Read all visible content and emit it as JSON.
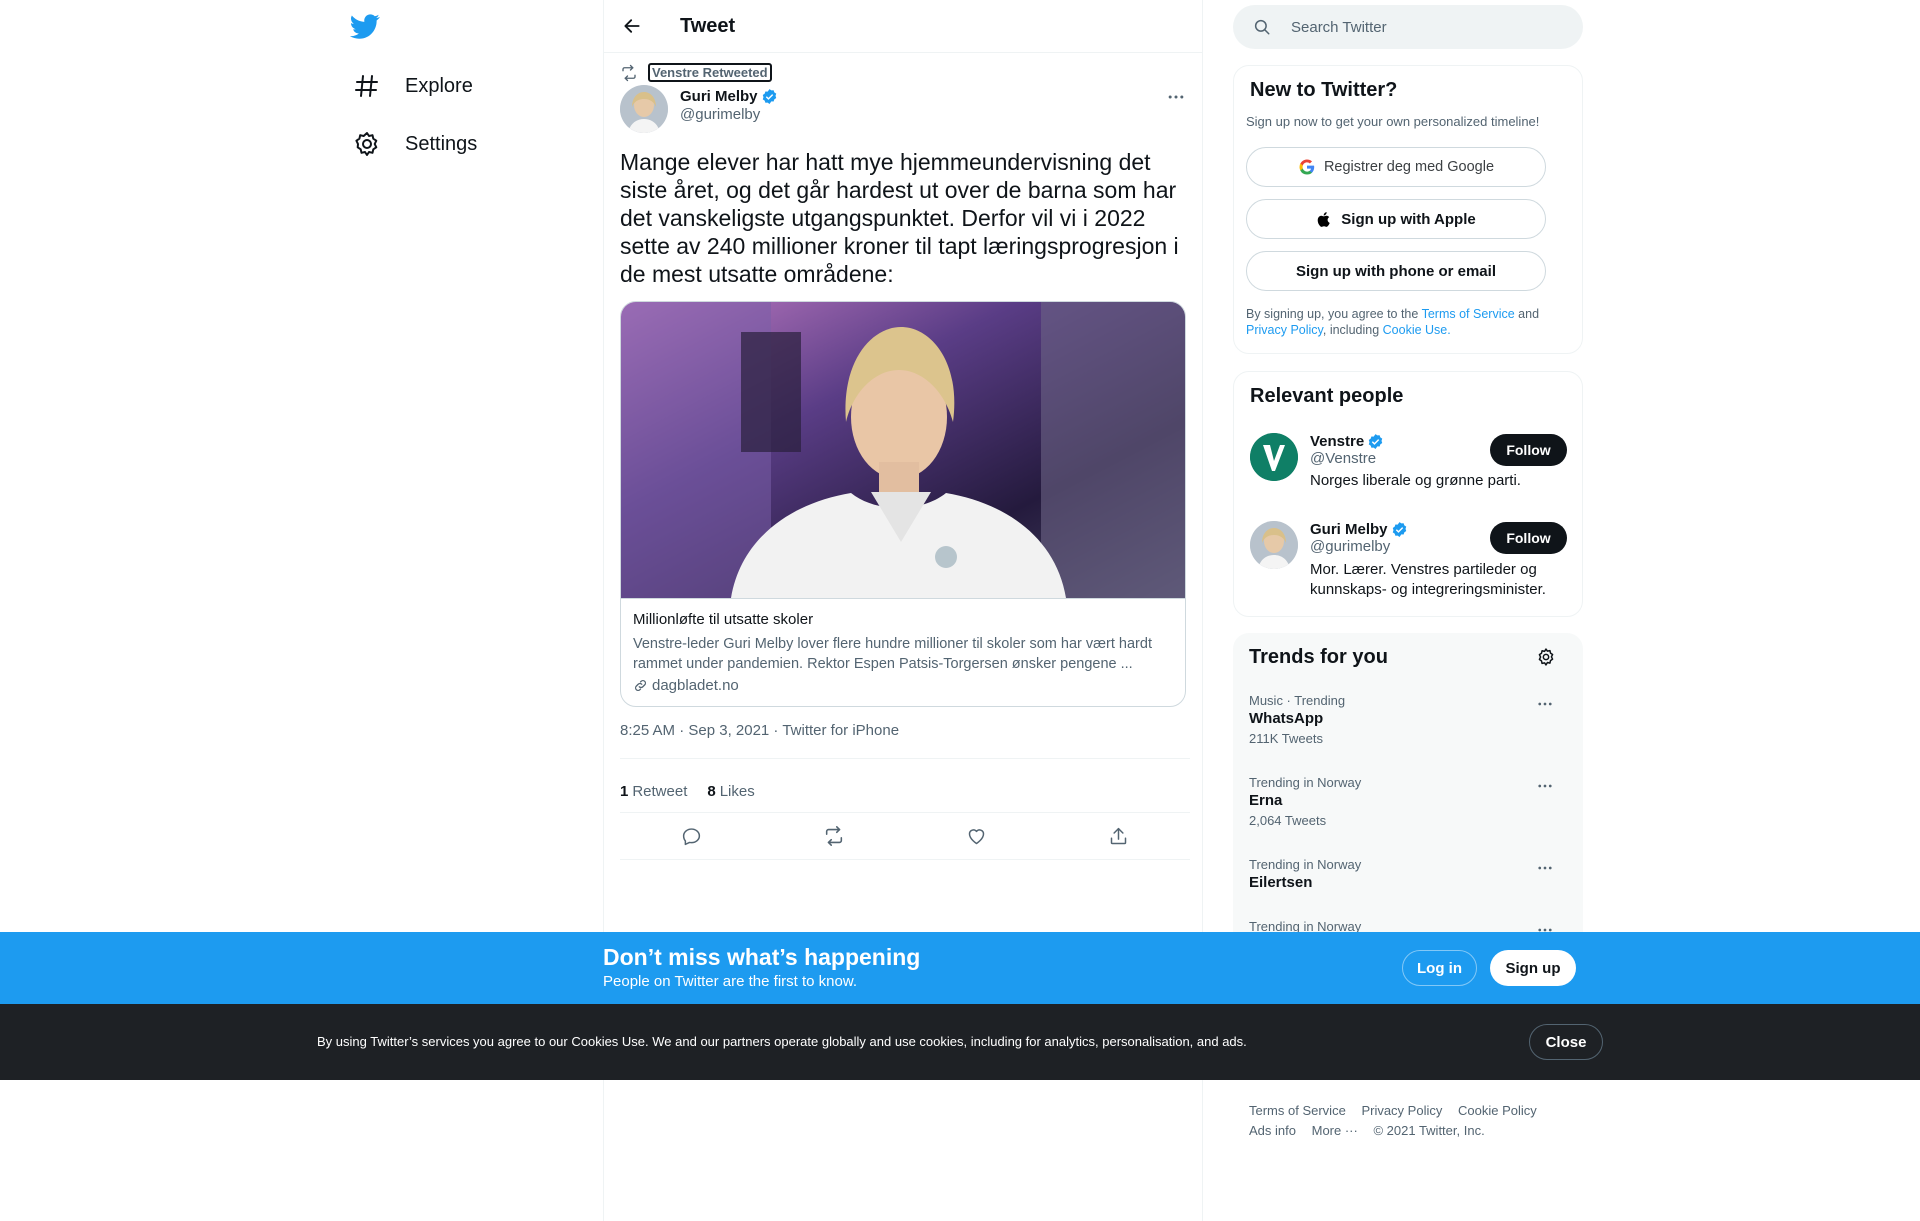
{
  "nav": {
    "items": [
      {
        "label": "Explore",
        "icon": "hashtag-icon"
      },
      {
        "label": "Settings",
        "icon": "gear-icon"
      }
    ]
  },
  "header": {
    "title": "Tweet"
  },
  "tweet": {
    "retweeted_by": "Venstre Retweeted",
    "author_name": "Guri Melby",
    "author_handle": "@gurimelby",
    "text": "Mange elever har hatt mye hjemmeundervisning det siste året, og det går hardest ut over de barna som har det vanskeligste utgangspunktet. Derfor vil vi i 2022 sette av 240 millioner kroner til tapt læringsprogresjon i de mest utsatte områdene:",
    "card": {
      "title": "Millionløfte til utsatte skoler",
      "description": "Venstre-leder Guri Melby lover flere hundre millioner til skoler som har vært hardt rammet under pandemien. Rektor Espen Patsis-Torgersen ønsker pengene ...",
      "domain": "dagbladet.no"
    },
    "meta": "8:25 AM · Sep 3, 2021 · Twitter for iPhone",
    "retweet_count": "1",
    "retweet_label": "Retweet",
    "like_count": "8",
    "like_label": "Likes"
  },
  "search": {
    "placeholder": "Search Twitter"
  },
  "signup_panel": {
    "title": "New to Twitter?",
    "subtitle": "Sign up now to get your own personalized timeline!",
    "google_label": "Registrer deg med Google",
    "apple_label": "Sign up with Apple",
    "phone_label": "Sign up with phone or email",
    "legal_prefix": "By signing up, you agree to the ",
    "legal_tos": "Terms of Service",
    "legal_and": " and",
    "legal_privacy": "Privacy Policy",
    "legal_including": ", including ",
    "legal_cookie": "Cookie Use."
  },
  "relevant_people": {
    "title": "Relevant people",
    "people": [
      {
        "name": "Venstre",
        "handle": "@Venstre",
        "bio": "Norges liberale og grønne parti.",
        "follow_label": "Follow"
      },
      {
        "name": "Guri Melby",
        "handle": "@gurimelby",
        "bio": "Mor. Lærer. Venstres partileder og kunnskaps- og integreringsminister.",
        "follow_label": "Follow"
      }
    ]
  },
  "trends": {
    "title": "Trends for you",
    "items": [
      {
        "context": "Music · Trending",
        "name": "WhatsApp",
        "count": "211K Tweets"
      },
      {
        "context": "Trending in Norway",
        "name": "Erna",
        "count": "2,064 Tweets"
      },
      {
        "context": "Trending in Norway",
        "name": "Eilertsen",
        "count": ""
      },
      {
        "context": "Trending in Norway",
        "name": "",
        "count": ""
      }
    ]
  },
  "footer": {
    "links_row1": [
      "Terms of Service",
      "Privacy Policy",
      "Cookie Policy"
    ],
    "links_row2": [
      "Ads info",
      "More ···",
      "© 2021 Twitter, Inc."
    ]
  },
  "login_banner": {
    "title": "Don’t miss what’s happening",
    "subtitle": "People on Twitter are the first to know.",
    "login_label": "Log in",
    "signup_label": "Sign up"
  },
  "cookie_banner": {
    "text": "By using Twitter’s services you agree to our Cookies Use. We and our partners operate globally and use cookies, including for analytics, personalisation, and ads.",
    "close_label": "Close"
  },
  "colors": {
    "accent": "#1d9bf0",
    "verified": "#1d9bf0",
    "dark": "#0f1419",
    "cookie_bg": "#1e2125"
  }
}
